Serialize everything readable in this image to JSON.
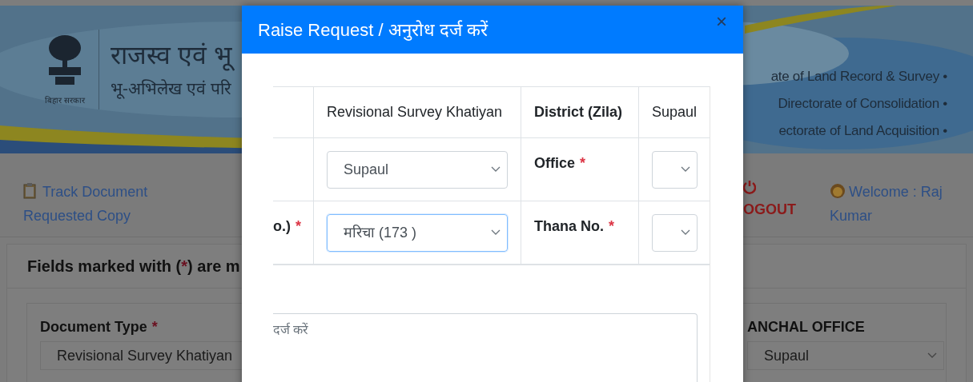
{
  "header": {
    "title": "राजस्व एवं भू",
    "subtitle": "भू-अभिलेख एवं परि",
    "logo_caption": "बिहार सरकार",
    "directorates": [
      "ate of Land Record & Survey •",
      "Directorate of Consolidation •",
      "ectorate of Land Acquisition •"
    ]
  },
  "nav": {
    "track_link": "Track Document Requested Copy",
    "logout": "OGOUT",
    "welcome": "Welcome : Raj Kumar"
  },
  "form": {
    "notice": {
      "before": "Fields marked with (",
      "mark": "*",
      "after": ") are m"
    },
    "fields": [
      {
        "label": "Document Type",
        "required": true,
        "value": "Revisional Survey Khatiyan"
      },
      {
        "label": "ANCHAL OFFICE",
        "required": false,
        "value": "Supaul"
      }
    ]
  },
  "modal": {
    "title": "Raise Request / अनुरोध दर्ज करें",
    "close": "×",
    "rows": [
      {
        "cells": [
          {
            "kind": "blank"
          },
          {
            "kind": "text",
            "text": "Revisional Survey Khatiyan"
          },
          {
            "kind": "label",
            "text": "District (Zila)",
            "required": false
          },
          {
            "kind": "text",
            "text": "Supaul"
          }
        ]
      },
      {
        "cells": [
          {
            "kind": "blank"
          },
          {
            "kind": "select",
            "value": "Supaul",
            "focused": false
          },
          {
            "kind": "label",
            "text": "Office",
            "required": true
          },
          {
            "kind": "select",
            "focused": false
          }
        ]
      },
      {
        "cells": [
          {
            "kind": "label",
            "text": "o.)",
            "required": true
          },
          {
            "kind": "select",
            "value": "मरिचा (173 )",
            "focused": true
          },
          {
            "kind": "label",
            "text": "Thana No.",
            "required": true
          },
          {
            "kind": "select",
            "focused": false
          }
        ]
      }
    ],
    "remarks": {
      "placeholder": "दर्ज करें"
    }
  }
}
